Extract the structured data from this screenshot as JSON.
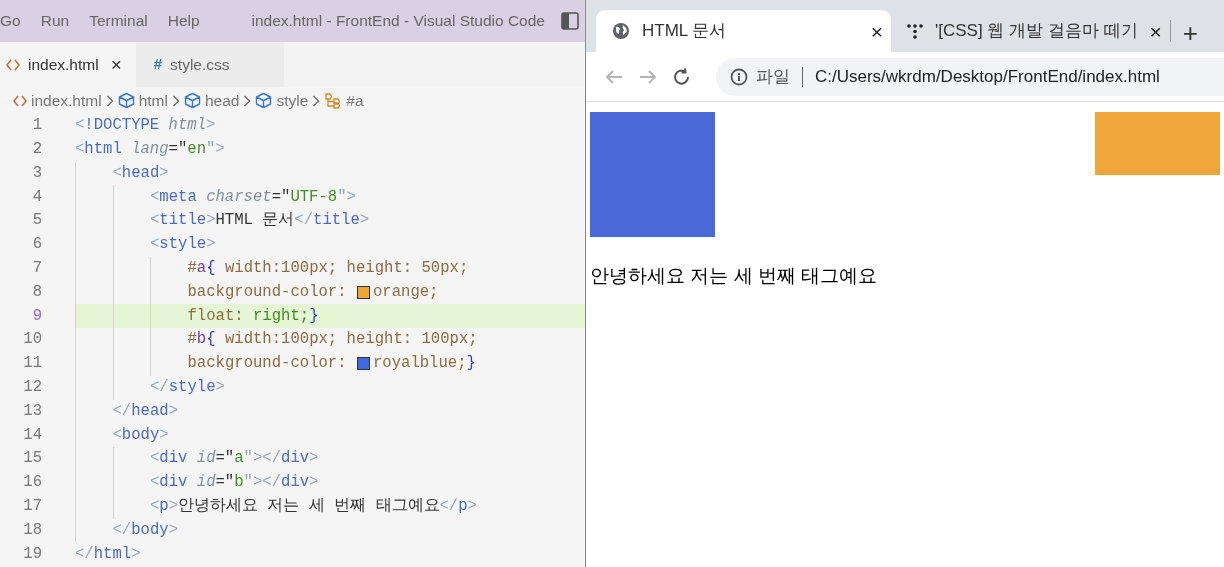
{
  "editor": {
    "menu": [
      "Go",
      "Run",
      "Terminal",
      "Help"
    ],
    "title": "index.html - FrontEnd - Visual Studio Code",
    "tabs": [
      {
        "label": "index.html",
        "kind": "html",
        "selected": true,
        "close": "×"
      },
      {
        "label": "style.css",
        "kind": "css",
        "icon": "#",
        "selected": false
      }
    ],
    "breadcrumb": [
      {
        "label": "index.html",
        "kind": "html"
      },
      {
        "label": "html",
        "kind": "element"
      },
      {
        "label": "head",
        "kind": "element"
      },
      {
        "label": "style",
        "kind": "element"
      },
      {
        "label": "#a",
        "kind": "selector"
      }
    ],
    "lines": [
      {
        "number": "1",
        "highlighted": false,
        "tokens": [
          {
            "t": "<",
            "kind": "p"
          },
          {
            "t": "!DOCTYPE ",
            "kind": "tag"
          },
          {
            "t": "html",
            "kind": "attr"
          },
          {
            "t": ">",
            "kind": "p"
          }
        ]
      },
      {
        "number": "2",
        "highlighted": false,
        "tokens": [
          {
            "t": "<",
            "kind": "p"
          },
          {
            "t": "html ",
            "kind": "tag"
          },
          {
            "t": "lang",
            "kind": "attr"
          },
          {
            "t": "=\"",
            "kind": "text"
          },
          {
            "t": "en",
            "kind": "str"
          },
          {
            "t": "\">",
            "kind": "p"
          }
        ],
        "children": [
          {
            "number": "3",
            "highlighted": false,
            "tokens": [
              {
                "t": "<",
                "kind": "p"
              },
              {
                "t": "head",
                "kind": "tag"
              },
              {
                "t": ">",
                "kind": "p"
              }
            ],
            "children": [
              {
                "number": "4",
                "highlighted": false,
                "tokens": [
                  {
                    "t": "<",
                    "kind": "p"
                  },
                  {
                    "t": "meta ",
                    "kind": "tag"
                  },
                  {
                    "t": "charset",
                    "kind": "attr"
                  },
                  {
                    "t": "=\"",
                    "kind": "text"
                  },
                  {
                    "t": "UTF-8",
                    "kind": "str"
                  },
                  {
                    "t": "\">",
                    "kind": "p"
                  }
                ]
              },
              {
                "number": "5",
                "highlighted": false,
                "tokens": [
                  {
                    "t": "<",
                    "kind": "p"
                  },
                  {
                    "t": "title",
                    "kind": "tag"
                  },
                  {
                    "t": ">",
                    "kind": "p"
                  },
                  {
                    "t": "HTML 문서",
                    "kind": "text"
                  },
                  {
                    "t": "</",
                    "kind": "p"
                  },
                  {
                    "t": "title",
                    "kind": "tag"
                  },
                  {
                    "t": ">",
                    "kind": "p"
                  }
                ]
              },
              {
                "number": "6",
                "highlighted": false,
                "tokens": [
                  {
                    "t": "<",
                    "kind": "p"
                  },
                  {
                    "t": "style",
                    "kind": "tag"
                  },
                  {
                    "t": ">",
                    "kind": "p"
                  }
                ],
                "children": [
                  {
                    "number": "7",
                    "highlighted": false,
                    "tokens": [
                      {
                        "t": "#",
                        "kind": "prop"
                      },
                      {
                        "t": "a",
                        "kind": "sel"
                      },
                      {
                        "t": "{",
                        "kind": "brace"
                      },
                      {
                        "t": " width:100px; height: 50px;",
                        "kind": "prop"
                      }
                    ]
                  },
                  {
                    "number": "8",
                    "highlighted": false,
                    "tokens": [
                      {
                        "t": "background-color: ",
                        "kind": "prop"
                      },
                      {
                        "kind": "swatch",
                        "color": "#f0a732"
                      },
                      {
                        "t": "orange;",
                        "kind": "prop"
                      }
                    ]
                  },
                  {
                    "number": "9",
                    "highlighted": true,
                    "tokens": [
                      {
                        "t": "float: ",
                        "kind": "prop"
                      },
                      {
                        "t": "right;",
                        "kind": "str"
                      },
                      {
                        "t": "}",
                        "kind": "brace"
                      }
                    ]
                  },
                  {
                    "number": "10",
                    "highlighted": false,
                    "tokens": [
                      {
                        "t": "#",
                        "kind": "prop"
                      },
                      {
                        "t": "b",
                        "kind": "sel"
                      },
                      {
                        "t": "{",
                        "kind": "brace"
                      },
                      {
                        "t": " width:100px; height: 100px;",
                        "kind": "prop"
                      }
                    ]
                  },
                  {
                    "number": "11",
                    "highlighted": false,
                    "tokens": [
                      {
                        "t": "background-color: ",
                        "kind": "prop"
                      },
                      {
                        "kind": "swatch",
                        "color": "#4169e1"
                      },
                      {
                        "t": "royalblue;",
                        "kind": "prop"
                      },
                      {
                        "t": "}",
                        "kind": "brace"
                      }
                    ]
                  }
                ]
              },
              {
                "number": "12",
                "highlighted": false,
                "tokens": [
                  {
                    "t": "</",
                    "kind": "p"
                  },
                  {
                    "t": "style",
                    "kind": "tag"
                  },
                  {
                    "t": ">",
                    "kind": "p"
                  }
                ]
              }
            ]
          },
          {
            "number": "13",
            "highlighted": false,
            "tokens": [
              {
                "t": "</",
                "kind": "p"
              },
              {
                "t": "head",
                "kind": "tag"
              },
              {
                "t": ">",
                "kind": "p"
              }
            ]
          },
          {
            "number": "14",
            "highlighted": false,
            "tokens": [
              {
                "t": "<",
                "kind": "p"
              },
              {
                "t": "body",
                "kind": "tag"
              },
              {
                "t": ">",
                "kind": "p"
              }
            ],
            "children": [
              {
                "number": "15",
                "highlighted": false,
                "tokens": [
                  {
                    "t": "<",
                    "kind": "p"
                  },
                  {
                    "t": "div ",
                    "kind": "tag"
                  },
                  {
                    "t": "id",
                    "kind": "attr"
                  },
                  {
                    "t": "=\"",
                    "kind": "text"
                  },
                  {
                    "t": "a",
                    "kind": "str"
                  },
                  {
                    "t": "\"></",
                    "kind": "p"
                  },
                  {
                    "t": "div",
                    "kind": "tag"
                  },
                  {
                    "t": ">",
                    "kind": "p"
                  }
                ]
              },
              {
                "number": "16",
                "highlighted": false,
                "tokens": [
                  {
                    "t": "<",
                    "kind": "p"
                  },
                  {
                    "t": "div ",
                    "kind": "tag"
                  },
                  {
                    "t": "id",
                    "kind": "attr"
                  },
                  {
                    "t": "=\"",
                    "kind": "text"
                  },
                  {
                    "t": "b",
                    "kind": "str"
                  },
                  {
                    "t": "\"></",
                    "kind": "p"
                  },
                  {
                    "t": "div",
                    "kind": "tag"
                  },
                  {
                    "t": ">",
                    "kind": "p"
                  }
                ]
              },
              {
                "number": "17",
                "highlighted": false,
                "tokens": [
                  {
                    "t": "<",
                    "kind": "p"
                  },
                  {
                    "t": "p",
                    "kind": "tag"
                  },
                  {
                    "t": ">",
                    "kind": "p"
                  },
                  {
                    "t": "안녕하세요 저는 세 번째 태그예요",
                    "kind": "text"
                  },
                  {
                    "t": "</",
                    "kind": "p"
                  },
                  {
                    "t": "p",
                    "kind": "tag"
                  },
                  {
                    "t": ">",
                    "kind": "p"
                  }
                ]
              }
            ]
          },
          {
            "number": "18",
            "highlighted": false,
            "tokens": [
              {
                "t": "</",
                "kind": "p"
              },
              {
                "t": "body",
                "kind": "tag"
              },
              {
                "t": ">",
                "kind": "p"
              }
            ]
          }
        ]
      },
      {
        "number": "19",
        "highlighted": false,
        "tokens": [
          {
            "t": "</",
            "kind": "p"
          },
          {
            "t": "html",
            "kind": "tag"
          },
          {
            "t": ">",
            "kind": "p"
          }
        ]
      }
    ]
  },
  "browser": {
    "tabs": [
      {
        "title": "HTML 문서",
        "kind": "globe",
        "selected": true,
        "close": "×"
      },
      {
        "title": "'[CSS] 웹 개발 걸음마 떼기",
        "kind": "dots",
        "selected": false,
        "close": "×"
      }
    ],
    "new_tab": "+",
    "back_disabled": true,
    "forward_disabled": true,
    "address": {
      "scheme_label": "파일",
      "url": "C:/Users/wkrdm/Desktop/FrontEnd/index.html"
    },
    "page": {
      "boxes": [
        {
          "kind": "float-right",
          "color": "#f0a73a"
        },
        {
          "kind": "block",
          "color": "#4a69d9"
        }
      ],
      "paragraph": "안녕하세요 저는 세 번째 태그예요"
    }
  }
}
